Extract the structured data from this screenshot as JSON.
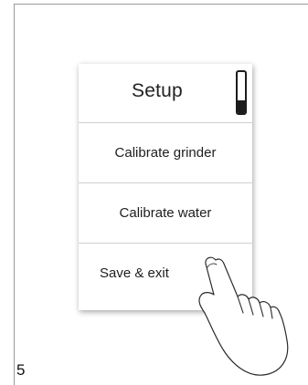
{
  "setup_panel": {
    "title": "Setup",
    "items": [
      {
        "label": "Calibrate grinder"
      },
      {
        "label": "Calibrate water"
      },
      {
        "label": "Save & exit"
      }
    ]
  },
  "step_number": "5",
  "icons": {
    "scroll_indicator": "scroll-position-indicator",
    "hand": "pointing-hand-icon"
  }
}
